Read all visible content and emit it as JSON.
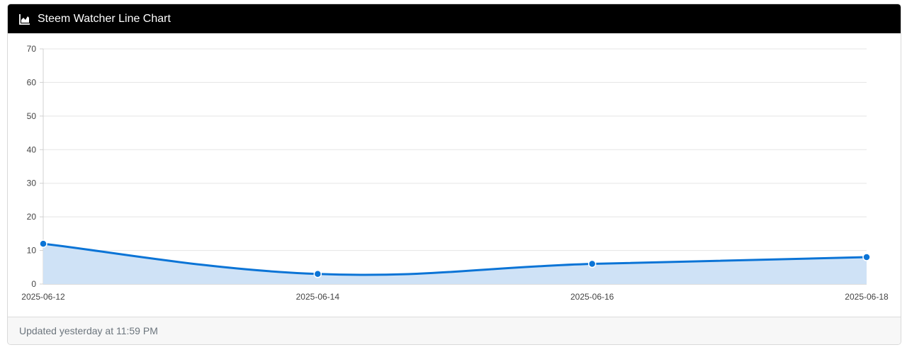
{
  "header": {
    "title": "Steem Watcher Line Chart",
    "icon": "area-chart-icon"
  },
  "footer": {
    "updated_text": "Updated yesterday at 11:59 PM"
  },
  "colors": {
    "line": "#0b74d6",
    "fill": "#cfe2f6",
    "header_bg": "#000000",
    "grid": "#e5e5e5"
  },
  "chart_data": {
    "type": "area",
    "title": "",
    "xlabel": "",
    "ylabel": "",
    "x": [
      "2025-06-12",
      "2025-06-14",
      "2025-06-16",
      "2025-06-18"
    ],
    "series": [
      {
        "values": [
          12,
          3,
          6,
          8
        ]
      }
    ],
    "ylim": [
      0,
      70
    ],
    "yticks": [
      0,
      10,
      20,
      30,
      40,
      50,
      60,
      70
    ],
    "grid": true,
    "legend": "none"
  }
}
